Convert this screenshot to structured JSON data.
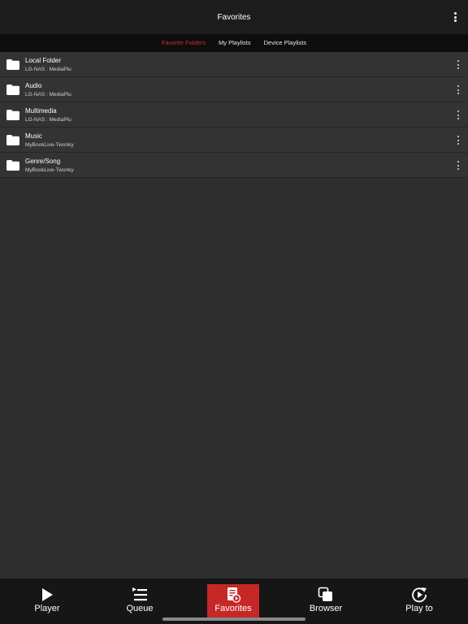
{
  "header": {
    "title": "Favorites",
    "menu_icon": "more-vertical-icon"
  },
  "tabs": [
    {
      "label": "Favorite Folders",
      "active": true
    },
    {
      "label": "My Playlists",
      "active": false
    },
    {
      "label": "Device Playlists",
      "active": false
    }
  ],
  "folders": [
    {
      "title": "Local Folder",
      "subtitle": "LG-NAS : MediaPlu"
    },
    {
      "title": "Audio",
      "subtitle": "LG-NAS : MediaPlu"
    },
    {
      "title": "Multimedia",
      "subtitle": "LG-NAS : MediaPlu"
    },
    {
      "title": "Music",
      "subtitle": "MyBookLive-Twonky"
    },
    {
      "title": "Genre/Song",
      "subtitle": "MyBookLive-Twonky"
    }
  ],
  "bottom_nav": [
    {
      "label": "Player",
      "icon": "play-icon",
      "active": false
    },
    {
      "label": "Queue",
      "icon": "queue-icon",
      "active": false
    },
    {
      "label": "Favorites",
      "icon": "favorites-icon",
      "active": true
    },
    {
      "label": "Browser",
      "icon": "browser-icon",
      "active": false
    },
    {
      "label": "Play to",
      "icon": "play-to-icon",
      "active": false
    }
  ],
  "colors": {
    "accent": "#c62828",
    "active_tab_text": "#d12b2b",
    "background": "#2e2e2e",
    "header": "#1c1c1c"
  }
}
